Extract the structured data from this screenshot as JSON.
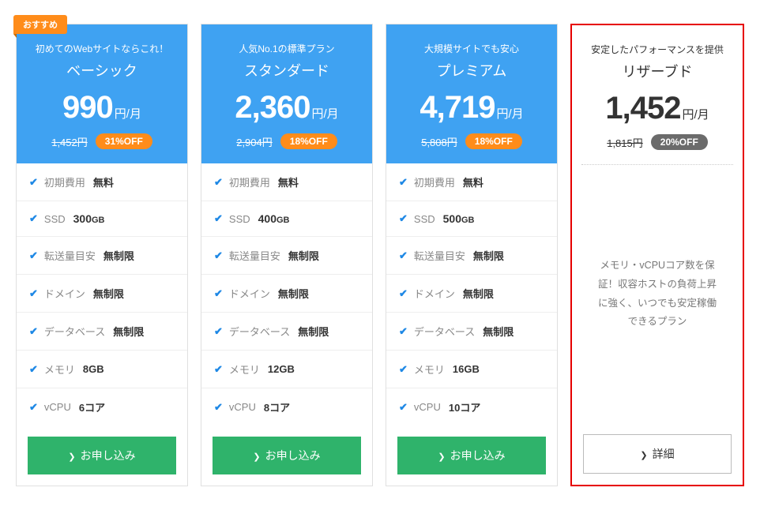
{
  "recommended_label": "おすすめ",
  "price_unit": "円/月",
  "cta_apply": "お申し込み",
  "cta_detail": "詳細",
  "feature_labels": {
    "initial_cost": "初期費用",
    "ssd": "SSD",
    "transfer": "転送量目安",
    "domain": "ドメイン",
    "database": "データベース",
    "memory": "メモリ",
    "vcpu": "vCPU"
  },
  "plans": [
    {
      "subtitle": "初めてのWebサイトならこれ！",
      "name": "ベーシック",
      "price": "990",
      "original": "1,452円",
      "off": "31%OFF",
      "features": {
        "initial_cost": "無料",
        "ssd_val": "300",
        "ssd_unit": "GB",
        "transfer": "無制限",
        "domain": "無制限",
        "database": "無制限",
        "memory": "8GB",
        "vcpu": "6コア"
      }
    },
    {
      "subtitle": "人気No.1の標準プラン",
      "name": "スタンダード",
      "price": "2,360",
      "original": "2,904円",
      "off": "18%OFF",
      "features": {
        "initial_cost": "無料",
        "ssd_val": "400",
        "ssd_unit": "GB",
        "transfer": "無制限",
        "domain": "無制限",
        "database": "無制限",
        "memory": "12GB",
        "vcpu": "8コア"
      }
    },
    {
      "subtitle": "大規模サイトでも安心",
      "name": "プレミアム",
      "price": "4,719",
      "original": "5,808円",
      "off": "18%OFF",
      "features": {
        "initial_cost": "無料",
        "ssd_val": "500",
        "ssd_unit": "GB",
        "transfer": "無制限",
        "domain": "無制限",
        "database": "無制限",
        "memory": "16GB",
        "vcpu": "10コア"
      }
    },
    {
      "subtitle": "安定したパフォーマンスを提供",
      "name": "リザーブド",
      "price": "1,452",
      "original": "1,815円",
      "off": "20%OFF",
      "description": "メモリ・vCPUコア数を保証！収容ホストの負荷上昇に強く、いつでも安定稼働できるプラン"
    }
  ]
}
